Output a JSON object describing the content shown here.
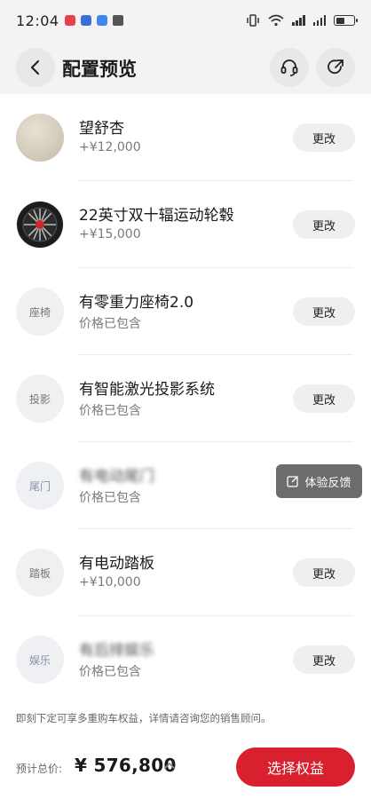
{
  "status_bar": {
    "time": "12:04",
    "notification_colors": [
      "#e8414d",
      "#3b6fd8",
      "#3f86f0",
      "#555555"
    ],
    "battery_level": 0.55
  },
  "header": {
    "title": "配置预览"
  },
  "items": [
    {
      "name": "望舒杏",
      "price": "+¥12,000",
      "thumb": "",
      "change": "更改"
    },
    {
      "name": "22英寸双十辐运动轮毂",
      "price": "+¥15,000",
      "thumb": "",
      "change": "更改"
    },
    {
      "name": "有零重力座椅2.0",
      "price": "价格已包含",
      "thumb": "座椅",
      "change": "更改"
    },
    {
      "name": "有智能激光投影系统",
      "price": "价格已包含",
      "thumb": "投影",
      "change": "更改"
    },
    {
      "name": "有电动尾门",
      "price": "价格已包含",
      "thumb": "尾门",
      "change": ""
    },
    {
      "name": "有电动踏板",
      "price": "+¥10,000",
      "thumb": "踏板",
      "change": "更改"
    },
    {
      "name": "有后排娱乐",
      "price": "价格已包含",
      "thumb": "娱乐",
      "change": "更改"
    }
  ],
  "feedback": {
    "label": "体验反馈"
  },
  "notice": "即刻下定可享多重购车权益，详情请咨询您的销售顾问。",
  "bottom": {
    "total_label": "预计总价:",
    "total_value": "¥ 576,800",
    "cta_label": "选择权益"
  },
  "colors": {
    "accent": "#d8202f",
    "header_bg": "#f3f3f3"
  }
}
